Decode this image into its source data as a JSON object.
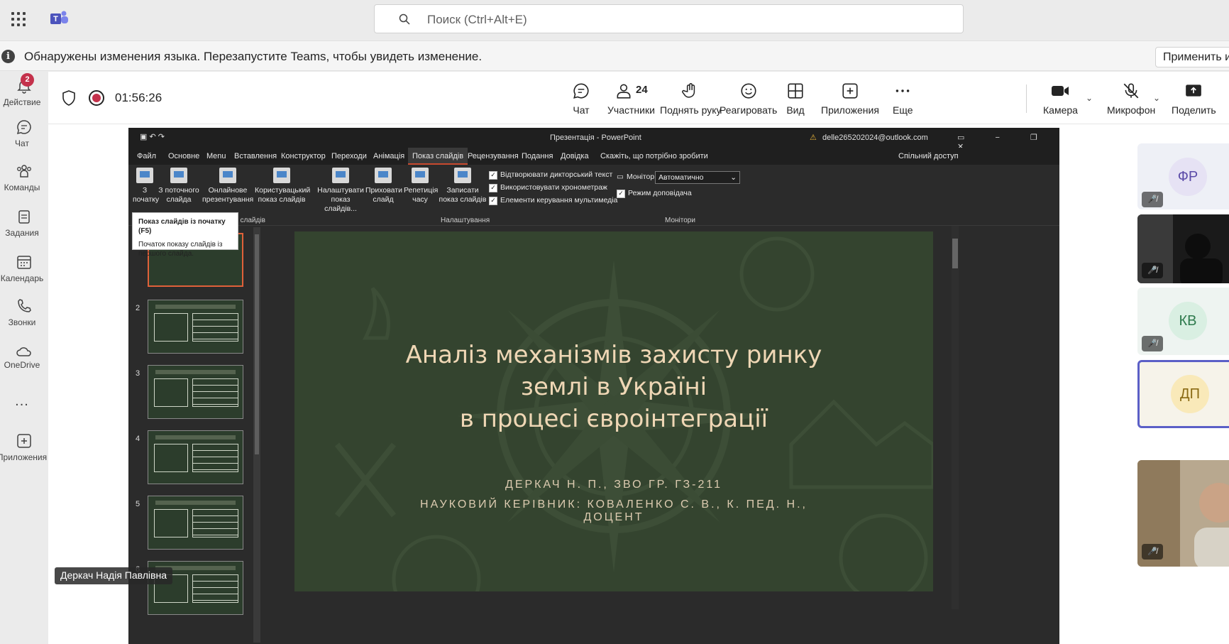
{
  "app": {
    "search_placeholder": "Поиск (Ctrl+Alt+E)"
  },
  "banner": {
    "text": "Обнаружены изменения языка. Перезапустите Teams, чтобы увидеть изменение.",
    "apply": "Применить и"
  },
  "rail": [
    {
      "label": "Действие",
      "badge": "2",
      "icon": "bell-icon"
    },
    {
      "label": "Чат",
      "icon": "chat-icon"
    },
    {
      "label": "Команды",
      "icon": "teams-icon"
    },
    {
      "label": "Задания",
      "icon": "assignments-icon"
    },
    {
      "label": "Календарь",
      "icon": "calendar-icon"
    },
    {
      "label": "Звонки",
      "icon": "phone-icon"
    },
    {
      "label": "OneDrive",
      "icon": "cloud-icon"
    },
    {
      "label": "...",
      "icon": "more-icon"
    },
    {
      "label": "Приложения",
      "icon": "apps-icon"
    }
  ],
  "meeting": {
    "timer": "01:56:26",
    "controls": {
      "chat": "Чат",
      "participants_count": "24",
      "participants": "Участники",
      "raise_hand": "Поднять руку",
      "react": "Реагировать",
      "view": "Вид",
      "apps": "Приложения",
      "more": "Еще",
      "camera": "Камера",
      "mic": "Микрофон",
      "share": "Поделить"
    },
    "presenter_name": "Деркач Надія Павлівна"
  },
  "ppt": {
    "window_title": "Презентація  -  PowerPoint",
    "account": "delle265202024@outlook.com",
    "tabs": [
      "Файл",
      "Основне",
      "Menu",
      "Вставлення",
      "Конструктор",
      "Переходи",
      "Анімація",
      "Показ слайдів",
      "Рецензування",
      "Подання",
      "Довідка"
    ],
    "tell_me": "Скажіть, що потрібно зробити",
    "share": "Спільний доступ",
    "ribbon": {
      "from_start": "З початку",
      "from_current": "З поточного слайда",
      "online": "Онлайнове презентування",
      "custom": "Користувацький показ слайдів",
      "group_start": "Початок показу слайдів",
      "setup": "Налаштувати показ слайдів...",
      "hide": "Приховати слайд",
      "rehearse": "Репетиція часу",
      "record": "Записати показ слайдів",
      "chk_narration": "Відтворювати дикторський текст",
      "chk_timings": "Використовувати хронометраж",
      "chk_media": "Елементи керування мультимедіа",
      "group_setup": "Налаштування",
      "monitor_label": "Монітор:",
      "monitor_value": "Автоматично",
      "presenter_view": "Режим доповідача",
      "group_monitors": "Монітори"
    },
    "tooltip": {
      "title": "Показ слайдів із початку (F5)",
      "body": "Початок показу слайдів із першого слайда."
    },
    "thumb_numbers": [
      "2",
      "3",
      "4",
      "5",
      "6"
    ],
    "slide": {
      "title_line1": "Аналіз механізмів захисту ринку",
      "title_line2": "землі в Україні",
      "title_line3": "в процесі євроінтеграції",
      "author": "ДЕРКАЧ Н. П., ЗВО ГР. ГЗ-211",
      "supervisor_line1": "НАУКОВИЙ КЕРІВНИК: КОВАЛЕНКО С. В., К. ПЕД. Н.,",
      "supervisor_line2": "ДОЦЕНТ"
    }
  },
  "participants": [
    {
      "initials": "ФР",
      "bg": "#f0eef8",
      "color": "#5b4ba8"
    },
    {
      "initials": "",
      "video": true
    },
    {
      "initials": "КВ",
      "bg": "#e6f3ec",
      "color": "#2e7a4d"
    },
    {
      "initials": "ДП",
      "bg": "#fbf3dd",
      "color": "#8a6a14",
      "active": true
    },
    {
      "initials": "",
      "video": true
    }
  ]
}
